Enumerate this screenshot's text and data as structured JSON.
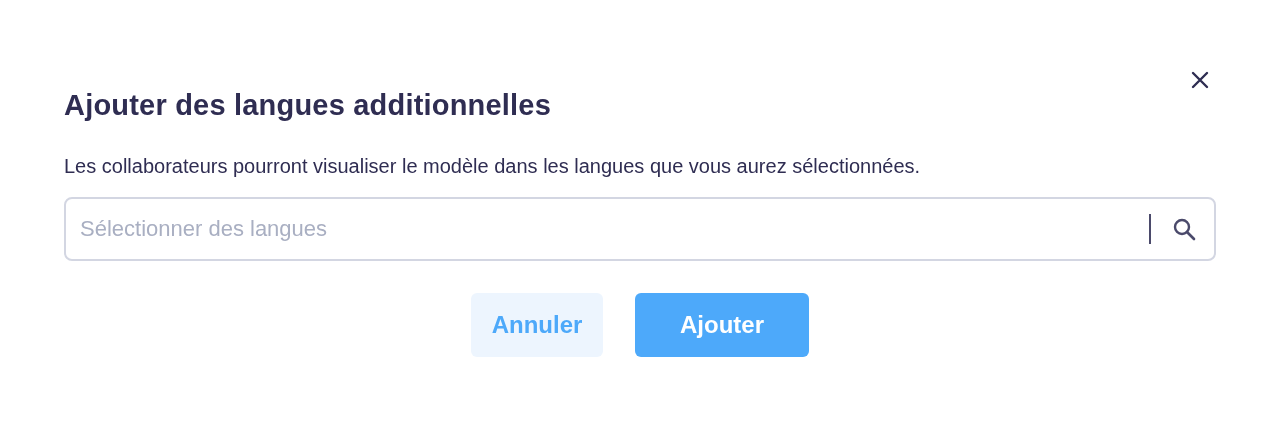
{
  "dialog": {
    "title": "Ajouter des langues additionnelles",
    "description": "Les collaborateurs pourront visualiser le modèle dans les langues que vous aurez sélectionnées.",
    "language_field": {
      "placeholder": "Sélectionner des langues"
    },
    "buttons": [
      {
        "label": "Annuler",
        "kind": "secondary"
      },
      {
        "label": "Ajouter",
        "kind": "primary"
      }
    ]
  }
}
